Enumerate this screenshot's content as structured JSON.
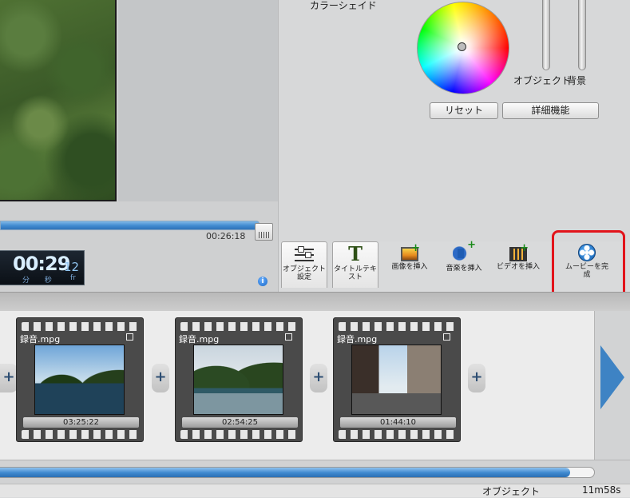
{
  "preview": {
    "total_time": "00:26:18",
    "timecode": {
      "main": "00:29",
      "frames": "12",
      "labels": "分 秒",
      "frame_label": "fr"
    },
    "info_icon": "info-icon"
  },
  "settings": {
    "color_shade_label": "カラーシェイド",
    "object_label": "オブジェクト",
    "background_label": "背景",
    "reset_label": "リセット",
    "advanced_label": "詳細機能"
  },
  "toolbar": {
    "object_settings": "オブジェクト設定",
    "title_text": "タイトルテキスト",
    "insert_image": "画像を挿入",
    "insert_music": "音楽を挿入",
    "insert_video": "ビデオを挿入",
    "finish_movie": "ムービーを完成",
    "title_glyph": "T"
  },
  "timeline": {
    "clips": [
      {
        "name": "録音.mpg",
        "duration": "03:25:22"
      },
      {
        "name": "録音.mpg",
        "duration": "02:54:25"
      },
      {
        "name": "録音.mpg",
        "duration": "01:44:10"
      }
    ],
    "add_symbol": "+",
    "scroll_fraction": 0.96
  },
  "status": {
    "label": "オブジェクト",
    "duration": "11m58s"
  },
  "colors": {
    "accent_blue": "#3e83c4",
    "highlight_red": "#e2141b"
  }
}
